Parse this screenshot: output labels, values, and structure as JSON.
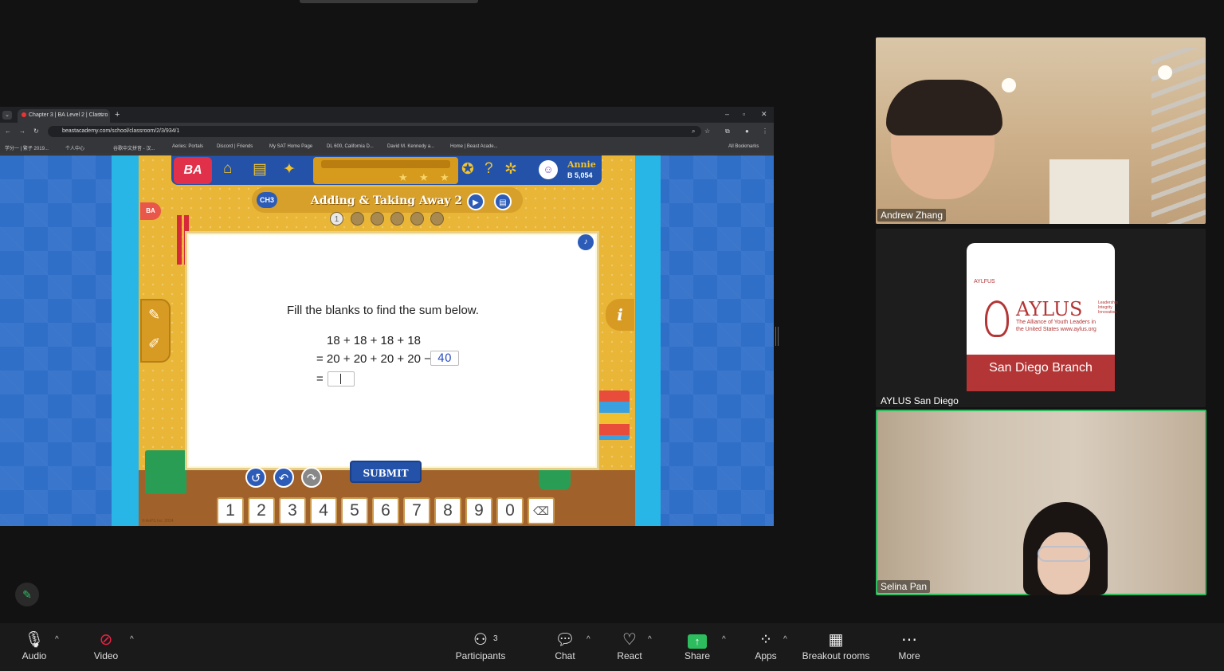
{
  "browser": {
    "tab_title": "Chapter 3 | BA Level 2 | Classro",
    "tab_close": "×",
    "new_tab": "+",
    "tab_menu": "⌄",
    "url": "beastacademy.com/school/classroom/2/3/934/1",
    "bookmarks": [
      "学分一 | 繁子 2019...",
      "个人中心",
      "谷歌中文拼音 - 汉...",
      "Aeries: Portals",
      "Discord | Friends",
      "My SAT Home Page",
      "DL 600, California D...",
      "David M. Kennedy a...",
      "Home | Beast Acade..."
    ],
    "all_bookmarks": "All Bookmarks"
  },
  "game": {
    "logo": "BA",
    "user_name": "Annie",
    "user_points": "B 5,054",
    "chapter_badge": "CH3",
    "side_badge": "BA",
    "lesson_title": "Adding & Taking Away 2",
    "steps": [
      "1",
      "",
      "",
      "",
      "",
      ""
    ],
    "prompt": "Fill the blanks to find the sum below.",
    "eq_line1": "18 + 18 + 18 + 18",
    "eq_line2": "= 20 + 20 + 20 + 20 −",
    "eq_line3": "=",
    "answer_value": "40",
    "submit_label": "SUBMIT",
    "keys": [
      "1",
      "2",
      "3",
      "4",
      "5",
      "6",
      "7",
      "8",
      "9",
      "0"
    ],
    "copyright": "© AoPS Inc. 2024"
  },
  "participants": [
    {
      "name": "Andrew Zhang"
    },
    {
      "name": "AYLUS San Diego"
    },
    {
      "name": "Selina Pan"
    }
  ],
  "aylus_card": {
    "small": "AYLFUS",
    "big": "AYLUS",
    "tagline": "Leadership Integrity Innovation",
    "sub": "The Alliance of Youth Leaders in the United States www.aylus.org",
    "branch": "San Diego Branch"
  },
  "toolbar": {
    "audio": "Audio",
    "video": "Video",
    "participants": "Participants",
    "participant_count": "3",
    "chat": "Chat",
    "react": "React",
    "share": "Share",
    "apps": "Apps",
    "breakout": "Breakout rooms",
    "more": "More"
  },
  "colors": {
    "accent_green": "#2dbd5f",
    "board_yellow": "#e9b637",
    "game_blue": "#2352a8",
    "aylus_red": "#b33535"
  }
}
